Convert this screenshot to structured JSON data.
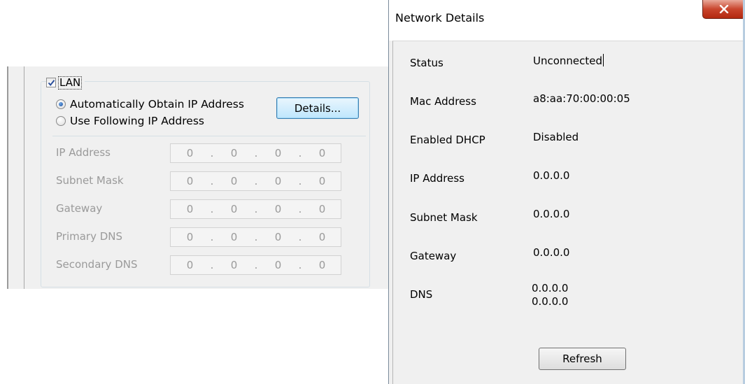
{
  "lan": {
    "checkbox_label": "LAN",
    "checked": true,
    "radio_auto": "Automatically Obtain IP Address",
    "radio_manual": "Use Following IP Address",
    "selected_radio": "auto",
    "details_button": "Details...",
    "fields": [
      {
        "label": "IP Address",
        "octets": [
          "0",
          "0",
          "0",
          "0"
        ]
      },
      {
        "label": "Subnet Mask",
        "octets": [
          "0",
          "0",
          "0",
          "0"
        ]
      },
      {
        "label": "Gateway",
        "octets": [
          "0",
          "0",
          "0",
          "0"
        ]
      },
      {
        "label": "Primary DNS",
        "octets": [
          "0",
          "0",
          "0",
          "0"
        ]
      },
      {
        "label": "Secondary DNS",
        "octets": [
          "0",
          "0",
          "0",
          "0"
        ]
      }
    ],
    "octet_separator": "."
  },
  "dialog": {
    "title": "Network Details",
    "close_icon": "close-icon",
    "close_glyph": "x",
    "rows": {
      "status": {
        "label": "Status",
        "value": "Unconnected"
      },
      "mac": {
        "label": "Mac Address",
        "value": "a8:aa:70:00:00:05"
      },
      "dhcp": {
        "label": "Enabled DHCP",
        "value": "Disabled"
      },
      "ip": {
        "label": "IP Address",
        "value": "0.0.0.0"
      },
      "subnet": {
        "label": "Subnet Mask",
        "value": "0.0.0.0"
      },
      "gateway": {
        "label": "Gateway",
        "value": "0.0.0.0"
      },
      "dns": {
        "label": "DNS",
        "value_1": "0.0.0.0",
        "value_2": "0.0.0.0"
      }
    },
    "refresh_button": "Refresh"
  },
  "colors": {
    "panel_bg": "#f0f0f0",
    "disabled_text": "#9a9a9a",
    "close_button": "#c9452d",
    "focus_button_border": "#3c7fb1"
  }
}
